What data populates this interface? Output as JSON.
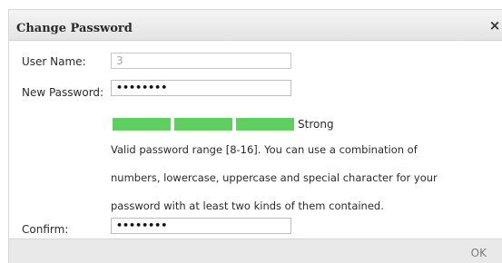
{
  "dialog": {
    "title": "Change Password",
    "close_icon": "close-icon",
    "close_glyph": "×"
  },
  "form": {
    "username_label": "User Name:",
    "username_value": "3",
    "new_password_label": "New Password:",
    "new_password_value": "••••••••",
    "confirm_label": "Confirm:",
    "confirm_value": "••••••••"
  },
  "strength": {
    "level_text": "Strong",
    "filled_segments": 3,
    "total_segments": 3,
    "color": "#5fcf5f"
  },
  "hint_lines": [
    "Valid password range [8-16]. You can use a combination of",
    "numbers, lowercase, uppercase and special character for your",
    "password with at least two kinds of them contained."
  ],
  "footer": {
    "ok_label": "OK"
  }
}
